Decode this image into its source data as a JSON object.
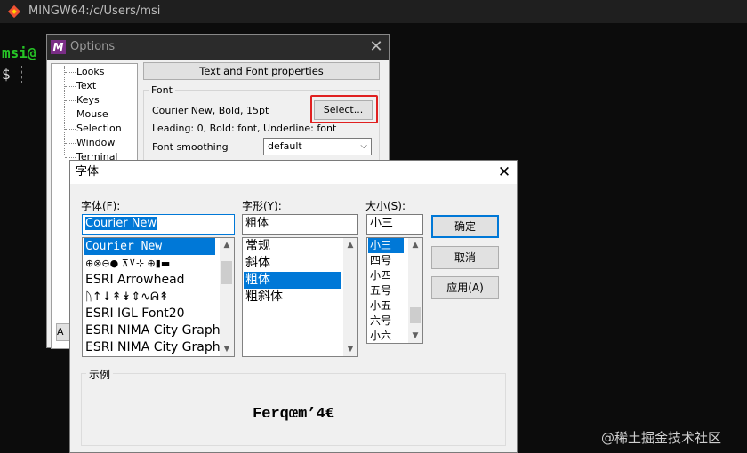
{
  "terminal": {
    "title": "MINGW64:/c/Users/msi",
    "prompt_user": "msi@",
    "prompt_symbol": "$"
  },
  "options": {
    "title": "Options",
    "logo": "M",
    "tree": [
      "Looks",
      "Text",
      "Keys",
      "Mouse",
      "Selection",
      "Window",
      "Terminal"
    ],
    "tab_button": "Text and Font properties",
    "font_group_label": "Font",
    "font_desc": "Courier New, Bold, 15pt",
    "select_button": "Select...",
    "leading_desc": "Leading: 0, Bold: font, Underline: font",
    "smoothing_label": "Font smoothing",
    "smoothing_value": "default",
    "bottom_button": "A",
    "highlight_color": "#e02020"
  },
  "font_dialog": {
    "title": "字体",
    "font_label": "字体(F):",
    "style_label": "字形(Y):",
    "size_label": "大小(S):",
    "font_value": "Courier New",
    "style_value": "粗体",
    "size_value": "小三",
    "fonts": [
      "Courier New",
      "⊕⊗⊖● ⊼⊻⊹ ⊕▮▬",
      "ESRI Arrowhead",
      "ᚢ↑↓↟↡⇕∿ᕱ↟",
      "ESRI IGL Font20",
      "ESRI NIMA City Graphi",
      "ESRI NIMA City Graphi"
    ],
    "selected_font_index": 0,
    "styles": [
      "常规",
      "斜体",
      "粗体",
      "粗斜体"
    ],
    "selected_style_index": 2,
    "sizes": [
      "小三",
      "四号",
      "小四",
      "五号",
      "小五",
      "六号",
      "小六"
    ],
    "selected_size_index": 0,
    "ok_button": "确定",
    "cancel_button": "取消",
    "apply_button": "应用(A)",
    "sample_label": "示例",
    "sample_text": "Ferqœm’4€",
    "accent_color": "#0078d7"
  },
  "watermark": "@稀土掘金技术社区"
}
